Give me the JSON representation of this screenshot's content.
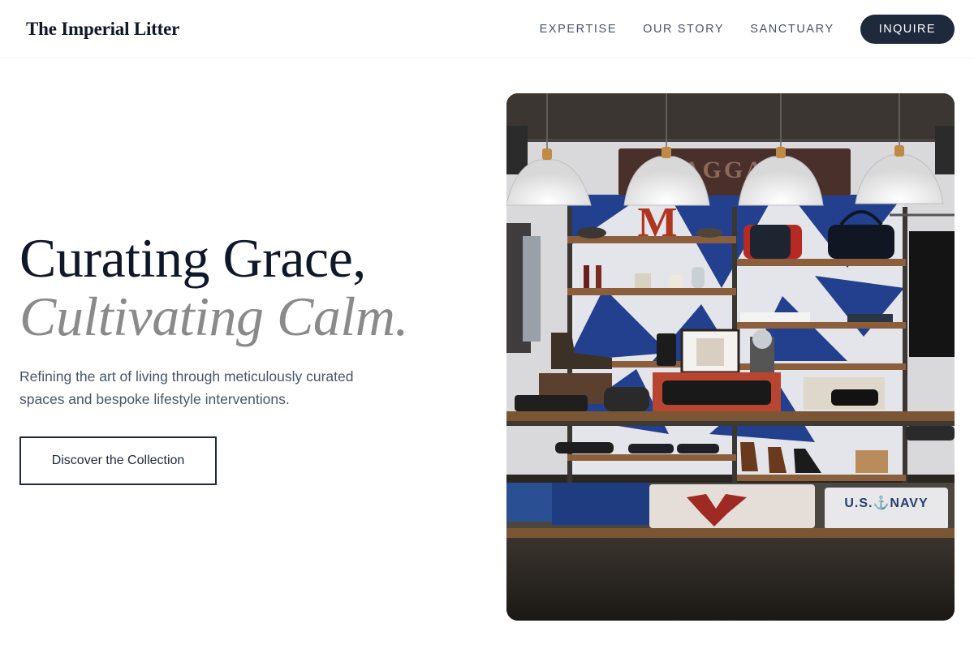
{
  "brand": {
    "name": "The Imperial Litter"
  },
  "nav": {
    "links": [
      "EXPERTISE",
      "OUR STORY",
      "SANCTUARY"
    ],
    "cta": "INQUIRE"
  },
  "hero": {
    "title_line1": "Curating Grace,",
    "title_line2": "Cultivating Calm.",
    "subtitle": "Refining the art of living through meticulously curated spaces and bespoke lifestyle interventions.",
    "button": "Discover the Collection",
    "image": {
      "subject": "boutique-store-interior",
      "sign_text": "BAGGAGE",
      "letter_decor": "M",
      "shirt_text": "U.S.⚓NAVY"
    }
  },
  "colors": {
    "primary": "#1e293b",
    "title": "#0f172a",
    "title_italic": "#8a8a8a",
    "body_text": "#475569"
  }
}
